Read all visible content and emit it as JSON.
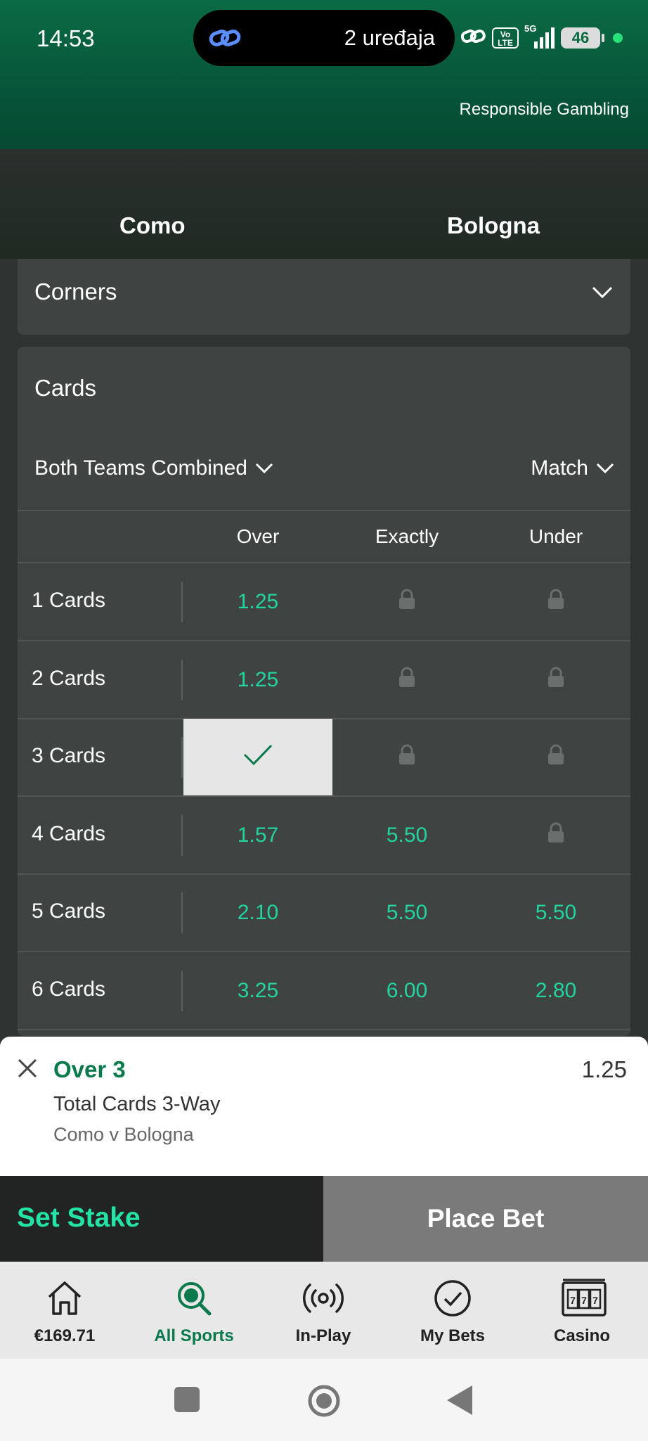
{
  "status_bar": {
    "time": "14:53",
    "devices": "2 uređaja",
    "network": "5G",
    "volte": "Vo LTE",
    "battery": "46"
  },
  "header": {
    "responsible_gambling": "Responsible Gambling",
    "home_team": "Como",
    "away_team": "Bologna"
  },
  "corners": {
    "title": "Corners"
  },
  "cards": {
    "title": "Cards",
    "filter_left": "Both Teams Combined",
    "filter_right": "Match",
    "columns": [
      "Over",
      "Exactly",
      "Under"
    ],
    "rows": [
      {
        "label": "1 Cards",
        "over": "1.25",
        "exactly": "",
        "under": ""
      },
      {
        "label": "2 Cards",
        "over": "1.25",
        "exactly": "",
        "under": ""
      },
      {
        "label": "3 Cards",
        "over": "",
        "exactly": "",
        "under": ""
      },
      {
        "label": "4 Cards",
        "over": "1.57",
        "exactly": "5.50",
        "under": ""
      },
      {
        "label": "5 Cards",
        "over": "2.10",
        "exactly": "5.50",
        "under": "5.50"
      },
      {
        "label": "6 Cards",
        "over": "3.25",
        "exactly": "6.00",
        "under": "2.80"
      }
    ]
  },
  "betslip": {
    "selection": "Over 3",
    "odds": "1.25",
    "market": "Total Cards 3-Way",
    "event": "Como v Bologna",
    "set_stake": "Set Stake",
    "place_bet": "Place Bet"
  },
  "bottom_nav": [
    {
      "label": "€169.71",
      "icon": "home-icon"
    },
    {
      "label": "All Sports",
      "icon": "search-icon"
    },
    {
      "label": "In-Play",
      "icon": "broadcast-icon"
    },
    {
      "label": "My Bets",
      "icon": "check-circle-icon"
    },
    {
      "label": "Casino",
      "icon": "slot-machine-icon"
    }
  ],
  "colors": {
    "brand_green": "#0a6b43",
    "odds_green": "#23d3a0",
    "panel": "#3f4341"
  }
}
